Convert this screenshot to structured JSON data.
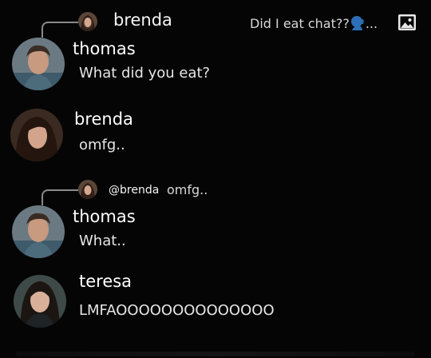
{
  "messages": [
    {
      "reply": {
        "author": "brenda",
        "text": "Did I eat chat??",
        "trail": "..."
      },
      "author": "thomas",
      "text": "What did you eat?"
    },
    {
      "author": "brenda",
      "text": "omfg.."
    },
    {
      "reply": {
        "author": "@brenda",
        "text": "omfg.."
      },
      "author": "thomas",
      "text": "What.."
    },
    {
      "author": "teresa",
      "text": "LMFAOOOOOOOOOOOOOO"
    }
  ],
  "icons": {
    "reply_attachment": "image-icon",
    "speaker": "speaking-head-icon"
  },
  "colors": {
    "background": "#050505",
    "speaker_emoji": "#2c6fb8"
  }
}
